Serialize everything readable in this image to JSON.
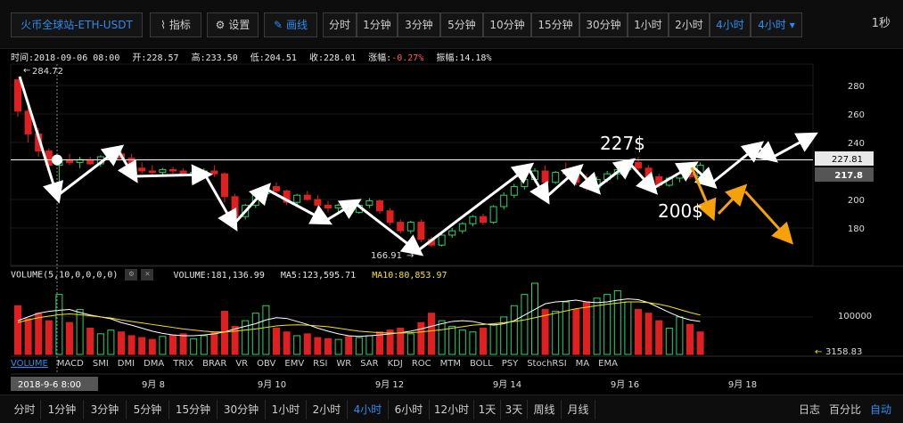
{
  "toolbar": {
    "symbol": "火币全球站-ETH-USDT",
    "indicator_btn": "指标",
    "settings_btn": "设置",
    "draw_btn": "画线",
    "intervals": [
      "分时",
      "1分钟",
      "3分钟",
      "5分钟",
      "10分钟",
      "15分钟",
      "30分钟",
      "1小时",
      "2小时",
      "4小时"
    ],
    "active_interval": "4小时",
    "dropdown_label": "4小时 ▾",
    "seconds_label": "1秒",
    "accent_color": "#2d8cf0"
  },
  "info": {
    "time_label": "时间:2018-09-06 08:00",
    "open_label": "开:228.57",
    "high_label": "高:233.50",
    "low_label": "低:204.51",
    "close_label": "收:228.01",
    "change_prefix": "涨幅:",
    "change_value": "-0.27%",
    "amplitude_label": "振幅:14.18%"
  },
  "volume_header": {
    "indicator": "VOLUME(5,10,0,0,0,0)",
    "volume_text": "VOLUME:181,136.99",
    "ma5_text": "MA5:123,595.71",
    "ma10_text": "MA10:80,853.97"
  },
  "indicator_tabs": [
    "VOLUME",
    "MACD",
    "SMI",
    "DMI",
    "DMA",
    "TRIX",
    "BRAR",
    "VR",
    "OBV",
    "EMV",
    "RSI",
    "WR",
    "SAR",
    "KDJ",
    "ROC",
    "MTM",
    "BOLL",
    "PSY",
    "StochRSI",
    "MA",
    "EMA"
  ],
  "active_indicator": "VOLUME",
  "bottom_bar": {
    "intervals": [
      "分时",
      "1分钟",
      "3分钟",
      "5分钟",
      "15分钟",
      "30分钟",
      "1小时",
      "2小时",
      "4小时",
      "6小时",
      "12小时",
      "1天",
      "3天",
      "周线",
      "月线"
    ],
    "active_interval": "4小时",
    "right_options": [
      "日志",
      "百分比",
      "自动"
    ],
    "active_right": "自动"
  },
  "chart_data": {
    "type": "candlestick",
    "price_axis_ticks": [
      280,
      260,
      240,
      200,
      180
    ],
    "price_range": [
      155,
      295
    ],
    "current_price": 227.81,
    "current_price_label": "227.81",
    "secondary_price": 217.8,
    "secondary_price_label": "217.8",
    "max_label": "284.72",
    "min_label": "166.91",
    "max_value": 284.72,
    "min_value": 166.91,
    "volume_axis_label": "100000",
    "volume_axis_value": 100000,
    "volume_max": 190000,
    "volume_current_label": "3158.83",
    "cursor_time_label": "2018-9-6  8:00",
    "date_ticks": [
      "9月 8",
      "9月 10",
      "9月 12",
      "9月 14",
      "9月 16",
      "9月 18"
    ],
    "annotation_227": "227$",
    "annotation_200": "200$",
    "colors": {
      "up": "#29d46a",
      "down": "#e02020",
      "annotation_white": "#ffffff",
      "annotation_orange": "#f5a20a",
      "ma5": "#ffffff",
      "ma10": "#f5e50a"
    },
    "candles": [
      [
        284,
        284.7,
        258,
        262
      ],
      [
        262,
        266,
        240,
        246
      ],
      [
        246,
        250,
        230,
        234
      ],
      [
        234,
        236,
        220,
        224
      ],
      [
        224,
        228,
        204.5,
        228
      ],
      [
        228,
        232,
        224,
        226
      ],
      [
        226,
        230,
        222,
        228
      ],
      [
        228,
        230,
        224,
        225
      ],
      [
        225,
        231,
        223,
        230
      ],
      [
        230,
        234,
        226,
        232
      ],
      [
        232,
        236,
        228,
        229
      ],
      [
        229,
        232,
        220,
        222
      ],
      [
        222,
        226,
        218,
        220
      ],
      [
        220,
        224,
        217,
        219
      ],
      [
        219,
        222,
        217,
        221
      ],
      [
        221,
        223,
        218,
        220
      ],
      [
        220,
        222,
        217,
        218
      ],
      [
        218,
        221,
        216,
        219
      ],
      [
        219,
        222,
        215,
        220
      ],
      [
        220,
        224,
        216,
        218
      ],
      [
        218,
        219,
        198,
        202
      ],
      [
        202,
        204,
        185,
        188
      ],
      [
        188,
        197,
        186,
        196
      ],
      [
        196,
        206,
        194,
        204
      ],
      [
        204,
        210,
        201,
        209
      ],
      [
        209,
        212,
        204,
        206
      ],
      [
        206,
        207,
        196,
        198
      ],
      [
        198,
        204,
        195,
        203
      ],
      [
        203,
        206,
        199,
        200
      ],
      [
        200,
        203,
        194,
        196
      ],
      [
        196,
        199,
        191,
        194
      ],
      [
        194,
        197,
        190,
        196
      ],
      [
        196,
        198,
        189,
        191
      ],
      [
        191,
        197,
        190,
        196
      ],
      [
        196,
        201,
        194,
        199
      ],
      [
        199,
        200,
        190,
        192
      ],
      [
        192,
        194,
        182,
        184
      ],
      [
        184,
        186,
        176,
        178
      ],
      [
        178,
        185,
        176,
        184
      ],
      [
        184,
        186,
        170,
        172
      ],
      [
        172,
        174,
        166.9,
        168
      ],
      [
        168,
        176,
        167,
        175
      ],
      [
        175,
        180,
        173,
        178
      ],
      [
        178,
        184,
        176,
        183
      ],
      [
        183,
        189,
        181,
        188
      ],
      [
        188,
        190,
        182,
        184
      ],
      [
        184,
        196,
        183,
        195
      ],
      [
        195,
        205,
        193,
        203
      ],
      [
        203,
        211,
        201,
        209
      ],
      [
        209,
        216,
        207,
        214
      ],
      [
        214,
        222,
        212,
        220
      ],
      [
        220,
        224,
        208,
        212
      ],
      [
        212,
        220,
        211,
        219
      ],
      [
        219,
        226,
        216,
        218
      ],
      [
        218,
        220,
        210,
        212
      ],
      [
        212,
        218,
        206,
        208
      ],
      [
        208,
        216,
        206,
        214
      ],
      [
        214,
        220,
        212,
        218
      ],
      [
        218,
        222,
        214,
        221
      ],
      [
        221,
        228,
        219,
        226
      ],
      [
        226,
        230,
        220,
        222
      ],
      [
        222,
        224,
        214,
        216
      ],
      [
        216,
        218,
        208,
        210
      ],
      [
        210,
        216,
        209,
        215
      ],
      [
        215,
        220,
        212,
        218
      ],
      [
        218,
        221,
        214,
        216
      ],
      [
        216,
        226,
        215,
        224
      ]
    ],
    "volume_color_pattern": [
      "down",
      "down",
      "down",
      "down",
      "up",
      "down",
      "up",
      "down",
      "up",
      "up",
      "down",
      "down",
      "down",
      "down",
      "up",
      "down",
      "down",
      "up",
      "up",
      "down",
      "down",
      "down",
      "up",
      "up",
      "up",
      "down",
      "down",
      "up",
      "down",
      "down",
      "down",
      "up",
      "down",
      "up",
      "up",
      "down",
      "down",
      "down",
      "up",
      "down",
      "down",
      "up",
      "up",
      "up",
      "up",
      "down",
      "up",
      "up",
      "up",
      "up",
      "up",
      "down",
      "up",
      "up",
      "down",
      "down",
      "up",
      "up",
      "up",
      "up",
      "down",
      "down",
      "down",
      "up",
      "up",
      "down",
      "down"
    ],
    "volumes": [
      130000,
      95000,
      110000,
      90000,
      160000,
      85000,
      120000,
      70000,
      55000,
      65000,
      60000,
      50000,
      45000,
      40000,
      48000,
      52000,
      55000,
      42000,
      50000,
      58000,
      115000,
      75000,
      90000,
      110000,
      130000,
      70000,
      60000,
      50000,
      55000,
      45000,
      42000,
      40000,
      48000,
      45000,
      50000,
      60000,
      65000,
      70000,
      55000,
      85000,
      110000,
      90000,
      75000,
      65000,
      60000,
      70000,
      80000,
      100000,
      130000,
      160000,
      190000,
      120000,
      115000,
      140000,
      120000,
      140000,
      150000,
      160000,
      170000,
      140000,
      120000,
      110000,
      90000,
      70000,
      100000,
      80000,
      60000
    ],
    "ma5": [
      90000,
      100000,
      110000,
      115000,
      118000,
      120000,
      112000,
      105000,
      100000,
      95000,
      85000,
      78000,
      70000,
      62000,
      56000,
      52000,
      50000,
      50000,
      52000,
      55000,
      60000,
      68000,
      75000,
      82000,
      92000,
      98000,
      96000,
      88000,
      80000,
      70000,
      62000,
      55000,
      50000,
      48000,
      50000,
      52000,
      55000,
      58000,
      62000,
      68000,
      75000,
      82000,
      88000,
      90000,
      88000,
      82000,
      78000,
      82000,
      90000,
      105000,
      120000,
      135000,
      140000,
      142000,
      145000,
      140000,
      138000,
      140000,
      145000,
      148000,
      146000,
      138000,
      125000,
      112000,
      100000,
      92000,
      88000
    ],
    "ma10": [
      85000,
      92000,
      98000,
      102000,
      106000,
      108000,
      106000,
      103000,
      100000,
      97000,
      92000,
      88000,
      84000,
      80000,
      76000,
      72000,
      68000,
      65000,
      62000,
      60000,
      60000,
      62000,
      65000,
      68000,
      72000,
      76000,
      78000,
      79000,
      78000,
      76000,
      74000,
      70000,
      66000,
      62000,
      60000,
      58000,
      57000,
      57000,
      58000,
      60000,
      63000,
      66000,
      70000,
      74000,
      78000,
      80000,
      82000,
      85000,
      88000,
      92000,
      98000,
      104000,
      110000,
      116000,
      122000,
      126000,
      130000,
      134000,
      137000,
      140000,
      140000,
      138000,
      134000,
      128000,
      120000,
      112000,
      105000
    ]
  }
}
